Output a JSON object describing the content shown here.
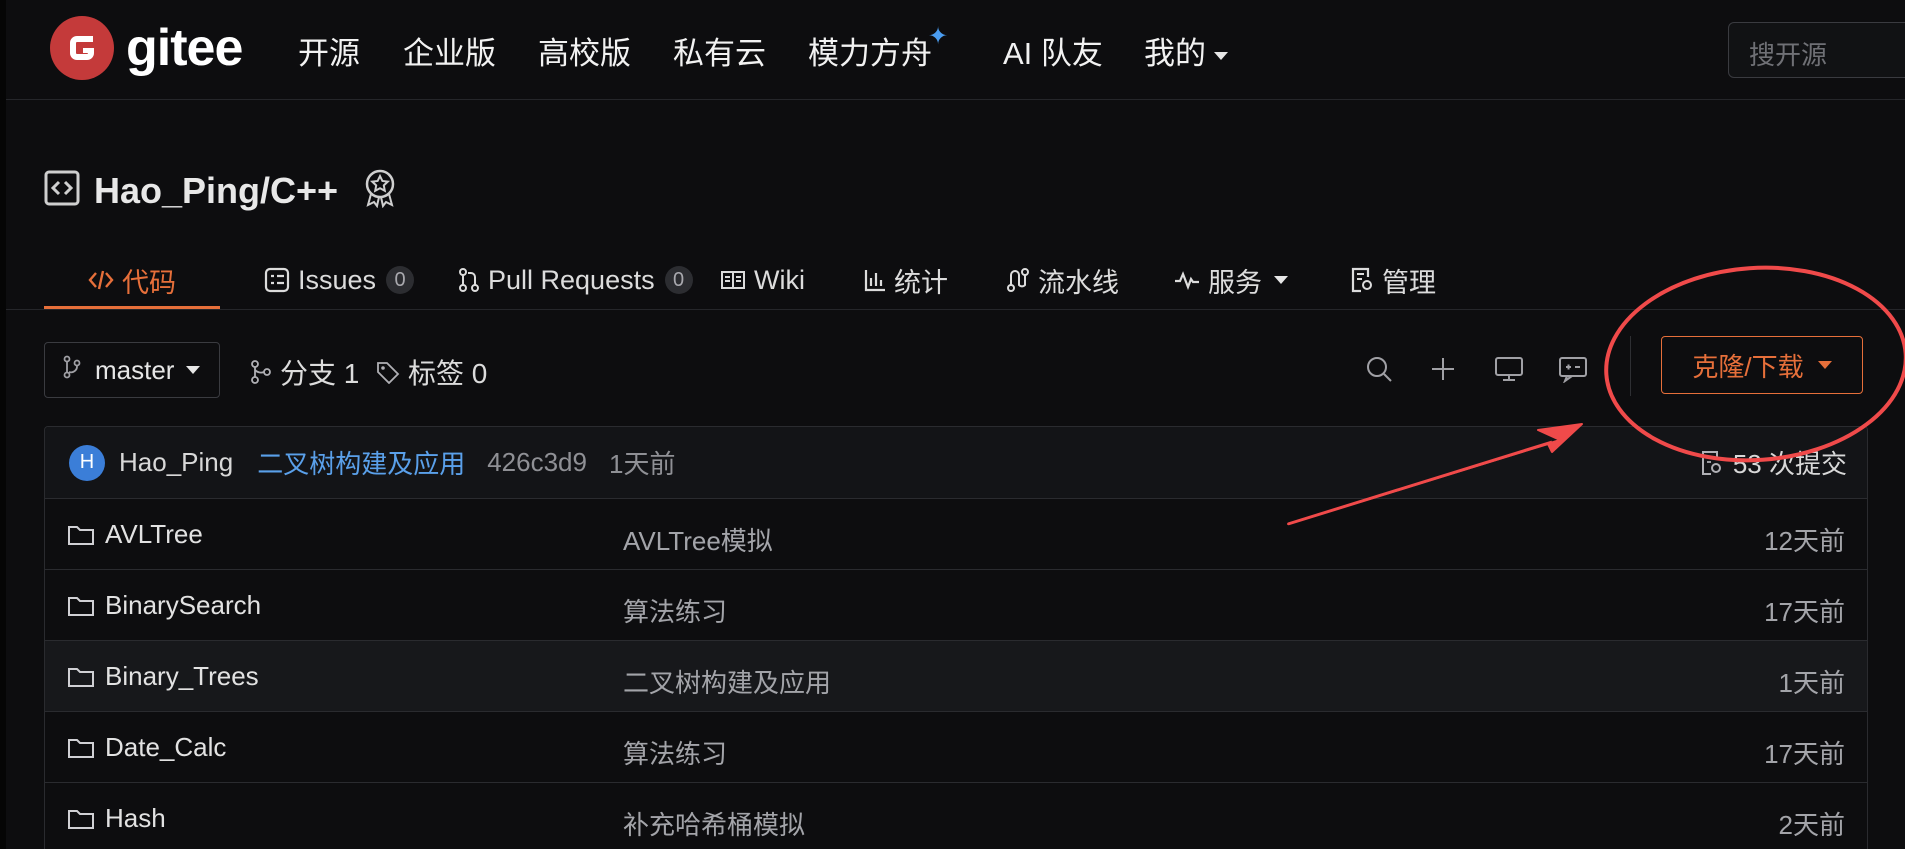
{
  "brand": {
    "name": "gitee",
    "color": "#c43a3a"
  },
  "nav": {
    "items": [
      "开源",
      "企业版",
      "高校版",
      "私有云",
      "模力方舟",
      "AI 队友",
      "我的"
    ],
    "search_placeholder": "搜开源"
  },
  "repo": {
    "title": "Hao_Ping/C++"
  },
  "tabs": [
    {
      "label": "代码",
      "active": true
    },
    {
      "label": "Issues",
      "count": "0"
    },
    {
      "label": "Pull Requests",
      "count": "0"
    },
    {
      "label": "Wiki"
    },
    {
      "label": "统计"
    },
    {
      "label": "流水线"
    },
    {
      "label": "服务"
    },
    {
      "label": "管理"
    }
  ],
  "toolbar": {
    "branch": "master",
    "branches": "分支 1",
    "tags": "标签 0",
    "clone_label": "克隆/下载"
  },
  "latest_commit": {
    "avatar_letter": "H",
    "author": "Hao_Ping",
    "message": "二叉树构建及应用",
    "hash": "426c3d9",
    "time": "1天前",
    "count": "53 次提交"
  },
  "files": [
    {
      "name": "AVLTree",
      "message": "AVLTree模拟",
      "time": "12天前"
    },
    {
      "name": "BinarySearch",
      "message": "算法练习",
      "time": "17天前"
    },
    {
      "name": "Binary_Trees",
      "message": "二叉树构建及应用",
      "time": "1天前"
    },
    {
      "name": "Date_Calc",
      "message": "算法练习",
      "time": "17天前"
    },
    {
      "name": "Hash",
      "message": "补充哈希桶模拟",
      "time": "2天前"
    }
  ],
  "colors": {
    "accent": "#e66f3a",
    "link": "#5aa0ea",
    "annotation": "#f04a4a"
  }
}
